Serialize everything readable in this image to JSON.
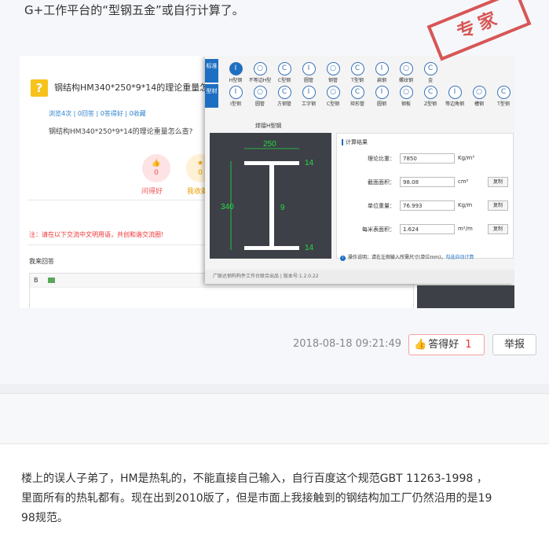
{
  "intro_text": "G+工作平台的“型钢五金”或自行计算了。",
  "screenshot": {
    "question": {
      "title": "钢结构HM340*250*9*14的理论重量怎么查",
      "stats": "浏览4次 | 0回答 | 0答得好 | 0收藏",
      "body": "钢结构HM340*250*9*14的理论重量怎么查?",
      "good_count": "0",
      "good_label": "问得好",
      "collect_count": "0",
      "collect_label": "我收藏",
      "good_icon": "thumb-icon",
      "collect_icon": "star-icon"
    },
    "notice": "注：请在以下交流中文明用语，共创和谐交流圈!",
    "my_answer_label": "我来回答",
    "editor_bold": "B",
    "app": {
      "tabs": [
        "标准",
        "型材"
      ],
      "row1": [
        "H型钢",
        "不等边H型",
        "C型钢",
        "圆管",
        "钢管",
        "T型钢",
        "扁钢",
        "螺纹钢",
        "金"
      ],
      "row2": [
        "I型钢",
        "圆管",
        "方钢管",
        "工字钢",
        "C型钢",
        "矩形管",
        "圆钢",
        "钢板",
        "Z型钢",
        "等边角钢",
        "槽钢",
        "T型钢"
      ],
      "panel_title": "焊接H型钢",
      "dims": {
        "width": "250",
        "height": "340",
        "web": "9",
        "flange_top": "14",
        "flange_bottom": "14"
      },
      "calc_title": "计算结果",
      "rows": [
        {
          "label": "理论比重：",
          "value": "7850",
          "unit": "Kg/m³",
          "btn": ""
        },
        {
          "label": "截面面积：",
          "value": "98.08",
          "unit": "cm²",
          "btn": "复制"
        },
        {
          "label": "单位重量：",
          "value": "76.993",
          "unit": "Kg/m",
          "btn": "复制"
        },
        {
          "label": "每米表面积：",
          "value": "1.624",
          "unit": "m²/m",
          "btn": "复制"
        }
      ],
      "tip": "操作说明：请在左侧输入所需尺寸(单位mm)，",
      "tip_link": "勾选自动计算",
      "status": "广联达钢构构件工作台联合出品  |  版本号:1.2.0.22"
    },
    "stamp": "专家"
  },
  "meta": {
    "timestamp": "2018-08-18 09:21:49",
    "like_label": "答得好",
    "like_count": "1",
    "report_label": "举报"
  },
  "answer_text": "楼上的误人子弟了，HM是热轧的，不能直接自己输入，自行百度这个规范GBT 11263-1998 ，里面所有的热轧都有。现在出到2010版了，但是市面上我接触到的钢结构加工厂仍然沿用的是1998规范。",
  "colors": {
    "accent": "#1d6fc2",
    "stamp": "#d23a3a",
    "like_count": "#e33333",
    "dim_green": "#22dd44"
  }
}
